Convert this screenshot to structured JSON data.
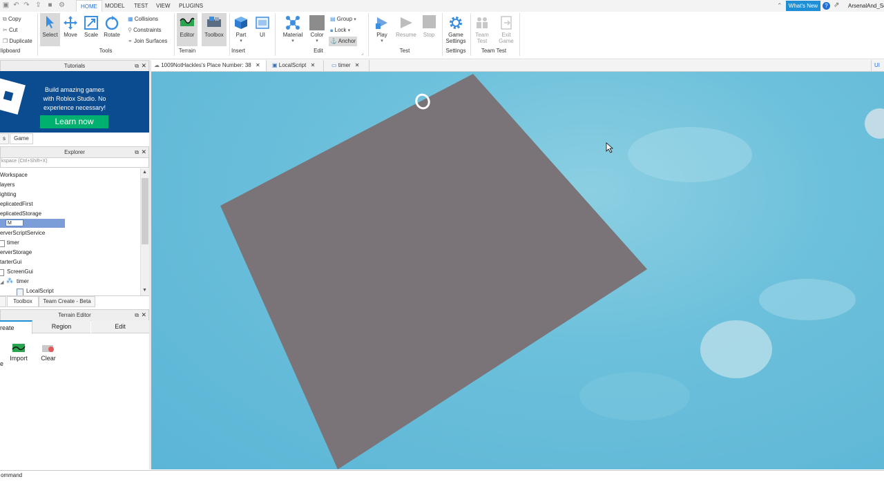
{
  "menubar": {
    "tabs": [
      "HOME",
      "MODEL",
      "TEST",
      "VIEW",
      "PLUGINS"
    ],
    "active_tab": "HOME",
    "whats_new": "What's New",
    "user": "ArsenalAnd_Sc"
  },
  "ribbon": {
    "clipboard": {
      "copy": "Copy",
      "cut": "Cut",
      "duplicate": "Duplicate",
      "label": "lipboard"
    },
    "tools": {
      "select": "Select",
      "move": "Move",
      "scale": "Scale",
      "rotate": "Rotate",
      "label": "Tools",
      "collisions": "Collisions",
      "constraints": "Constraints",
      "join_surfaces": "Join Surfaces"
    },
    "terrain": {
      "editor": "Editor",
      "toolbox": "Toolbox",
      "label": "Terrain"
    },
    "insert": {
      "part": "Part",
      "ui": "UI",
      "label": "Insert"
    },
    "edit": {
      "material": "Material",
      "color": "Color",
      "group": "Group",
      "lock": "Lock",
      "anchor": "Anchor",
      "label": "Edit"
    },
    "test": {
      "play": "Play",
      "resume": "Resume",
      "stop": "Stop",
      "label": "Test"
    },
    "settings": {
      "game_settings_1": "Game",
      "game_settings_2": "Settings",
      "label": "Settings"
    },
    "team_test": {
      "team_test_1": "Team",
      "team_test_2": "Test",
      "exit_game_1": "Exit",
      "exit_game_2": "Game",
      "label": "Team Test"
    }
  },
  "tutorials": {
    "title": "Tutorials",
    "banner_line1": "Build amazing games",
    "banner_line2": "with Roblox Studio. No",
    "banner_line3": "experience necessary!",
    "learn_now": "Learn now",
    "tab_left": "s",
    "tab_game": "Game"
  },
  "explorer": {
    "title": "Explorer",
    "search_placeholder": "kspace (Ctrl+Shift+X)",
    "items": [
      "Workspace",
      "layers",
      "ighting",
      "eplicatedFirst",
      "eplicatedStorage",
      "M",
      "erverScriptService",
      "timer",
      "erverStorage",
      "tarterGui",
      "ScreenGui",
      "timer",
      "LocalScript"
    ],
    "tabs": [
      "Toolbox",
      "Team Create - Beta"
    ]
  },
  "terrain_editor": {
    "title": "Terrain Editor",
    "tabs": [
      "reate",
      "Region",
      "Edit"
    ],
    "tools": [
      "e",
      "Import",
      "Clear"
    ]
  },
  "doc_tabs": [
    "1009NotHackles's Place Number: 38",
    "LocalScript",
    "timer"
  ],
  "doc_tab_right": "UI c",
  "command_bar": "ommand",
  "colors": {
    "accent": "#1e8fd6",
    "learn_now": "#00b06f",
    "banner_bg": "#0b4b8f",
    "part": "#7a7478",
    "selection": "#7b9ed9"
  }
}
